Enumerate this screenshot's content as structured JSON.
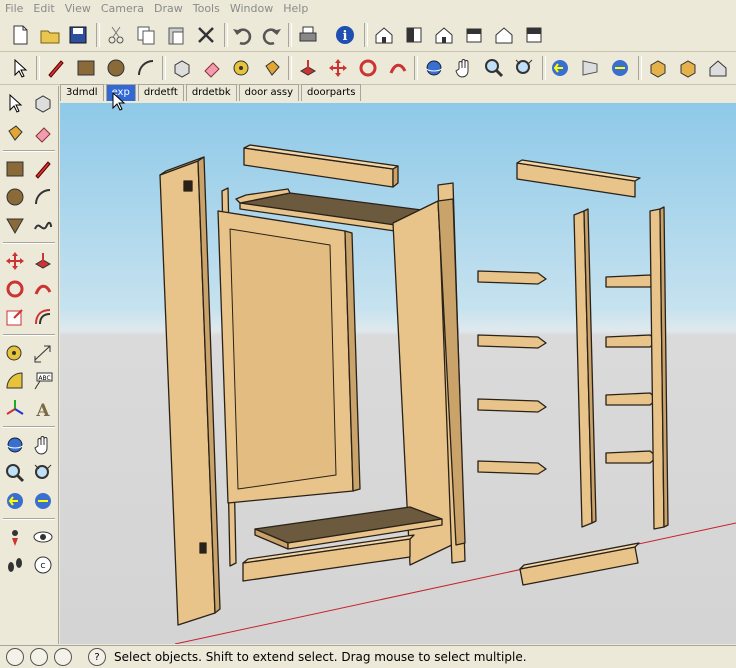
{
  "menu": [
    "File",
    "Edit",
    "View",
    "Camera",
    "Draw",
    "Tools",
    "Window",
    "Help"
  ],
  "scene_tabs": [
    {
      "label": "3dmdl"
    },
    {
      "label": "exp"
    },
    {
      "label": "drdetft"
    },
    {
      "label": "drdetbk"
    },
    {
      "label": "door assy"
    },
    {
      "label": "doorparts"
    }
  ],
  "active_tab": "exp",
  "status": {
    "help_icon": "?",
    "text": "Select objects. Shift to extend select. Drag mouse to select multiple."
  },
  "colors": {
    "wood": "#e8c48a",
    "wood_dark": "#c9a36a",
    "shelf": "#6b5a3e",
    "sky": "#8ec9e8",
    "ground": "#d4d4d4",
    "axis_red": "#c8202a",
    "tab_active": "#3168d4"
  }
}
